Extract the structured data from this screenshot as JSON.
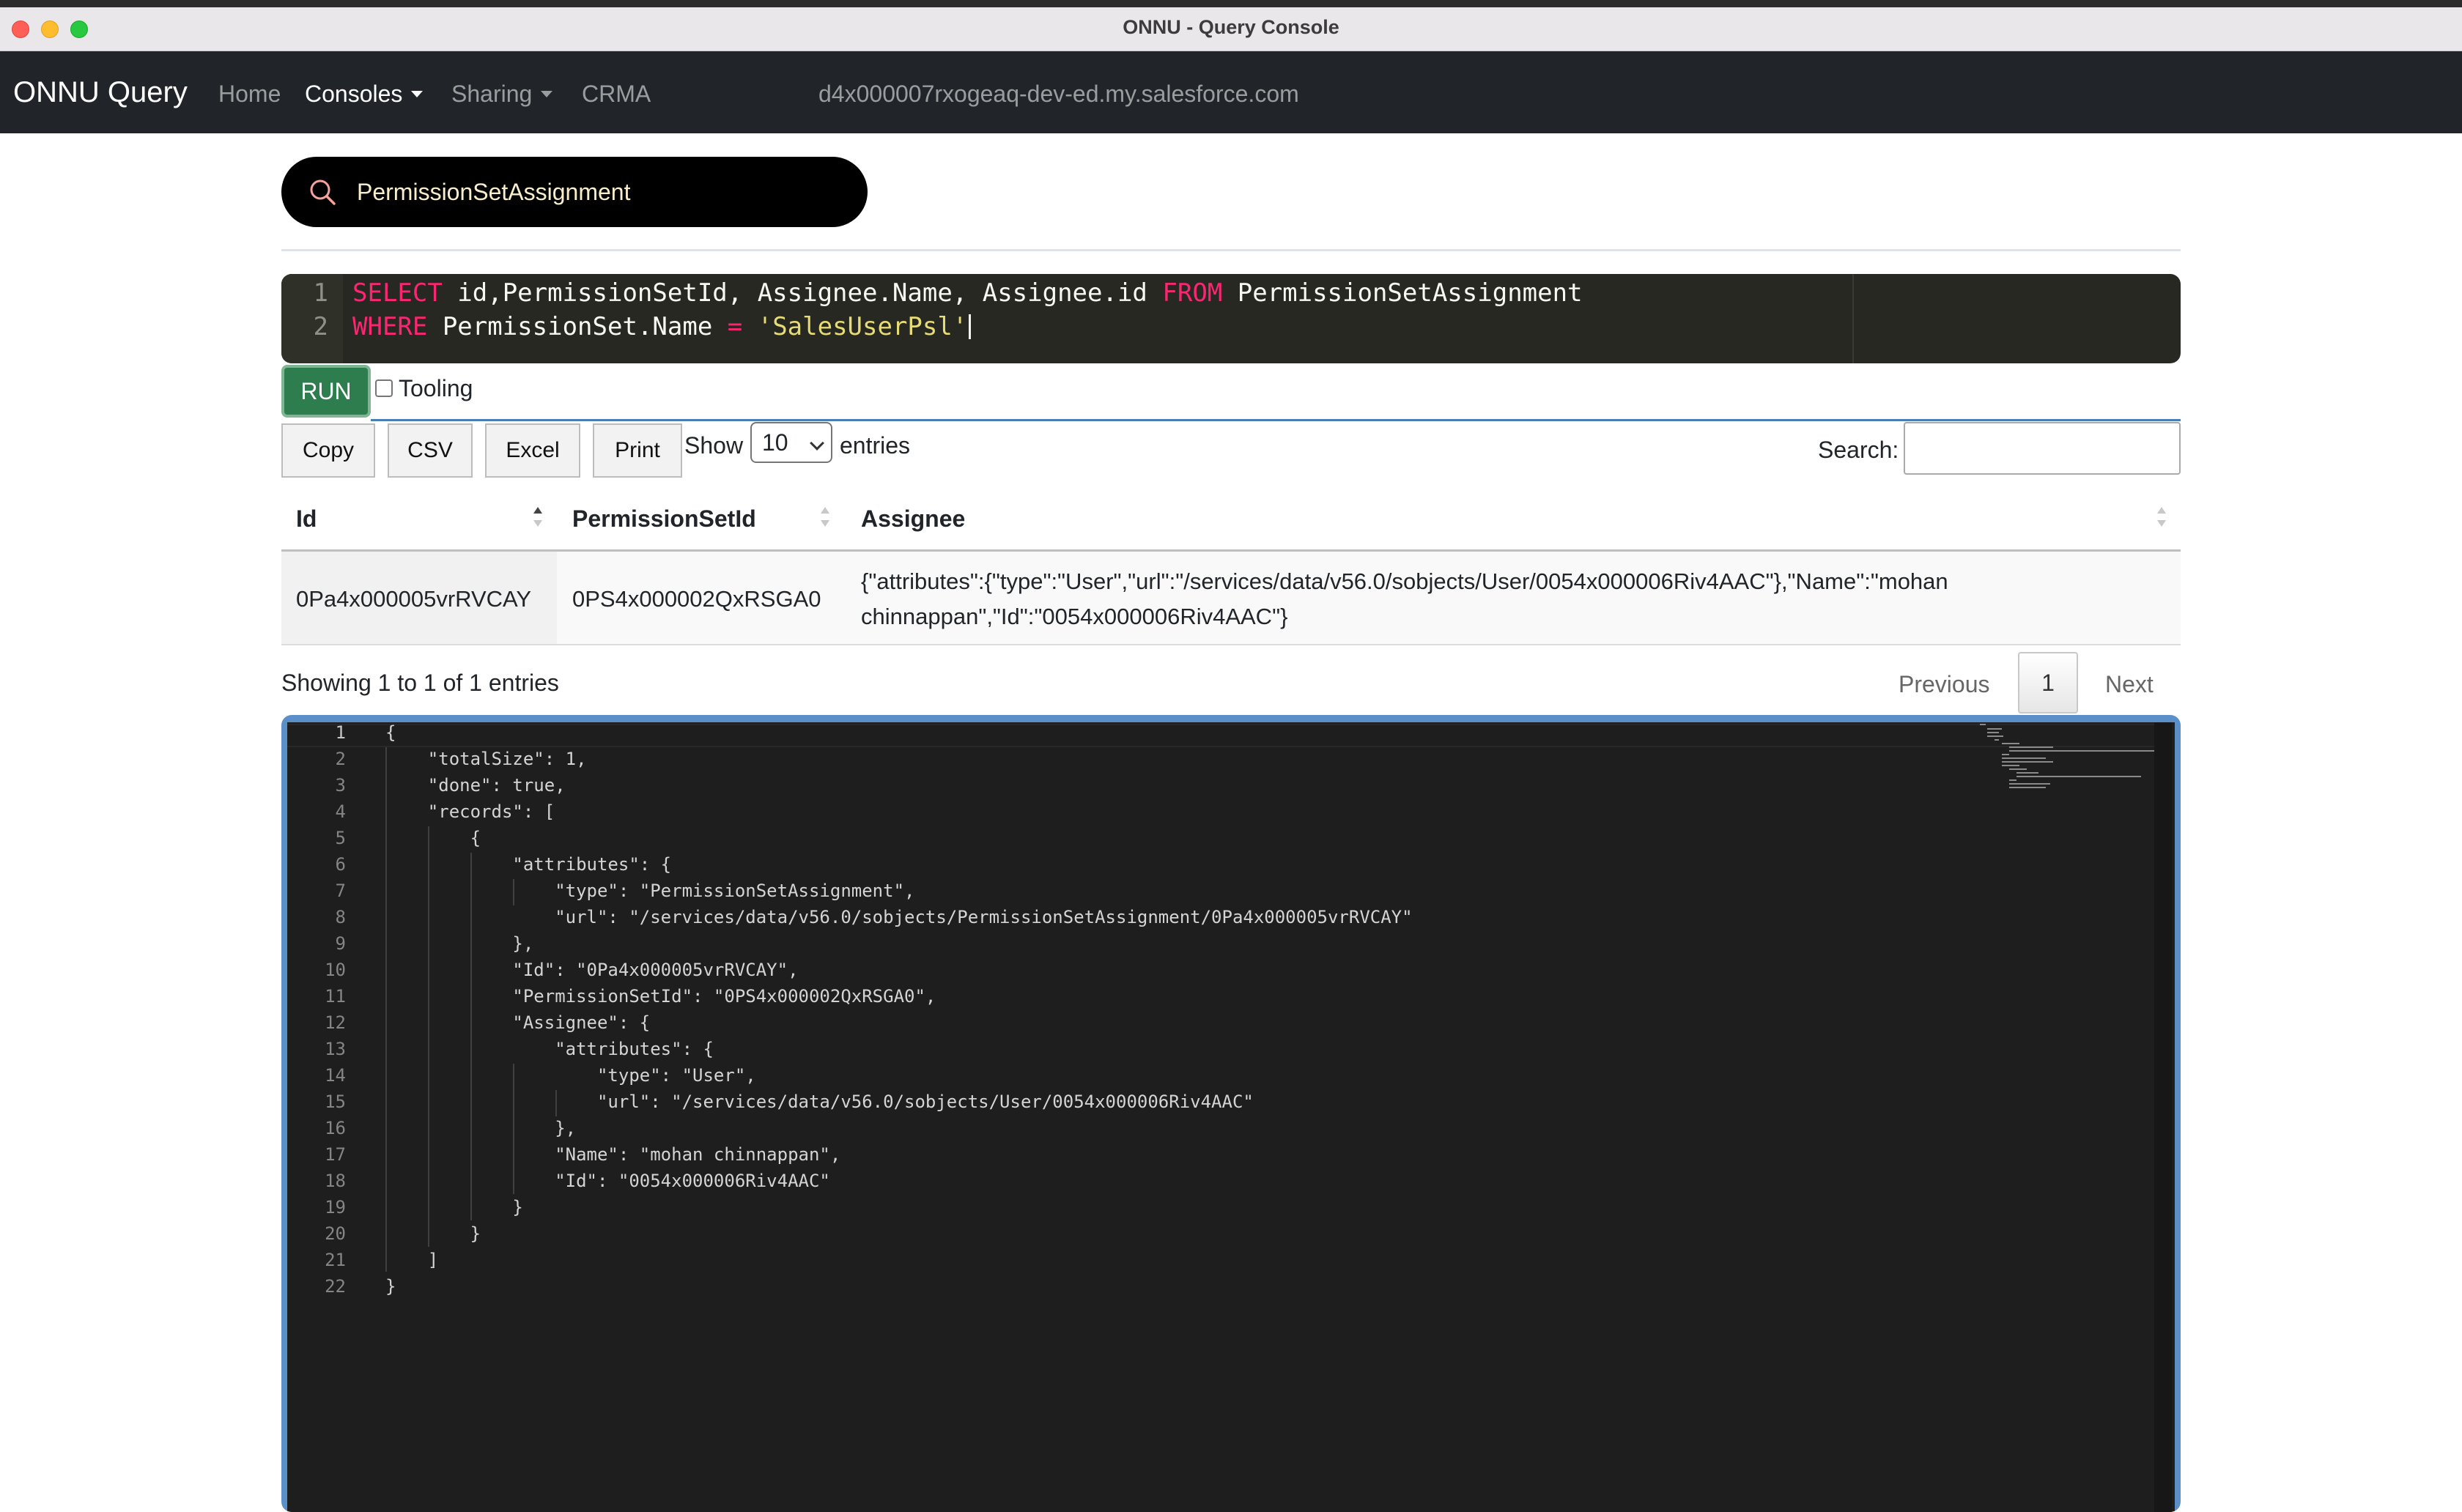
{
  "window": {
    "title": "ONNU - Query Console"
  },
  "navbar": {
    "brand": "ONNU Query",
    "links": {
      "home": "Home",
      "consoles": "Consoles",
      "sharing": "Sharing",
      "crma": "CRMA"
    },
    "host": "d4x000007rxogeaq-dev-ed.my.salesforce.com"
  },
  "search": {
    "value": "PermissionSetAssignment",
    "accent_color": "#f4a29b"
  },
  "editor": {
    "line_numbers": [
      "1",
      "2"
    ],
    "line1": {
      "kw1": "SELECT",
      "fields": " id,PermissionSetId, Assignee.Name, Assignee.id ",
      "kw2": "FROM",
      "object": " PermissionSetAssignment"
    },
    "line2": {
      "kw": "WHERE",
      "field": " PermissionSet.Name ",
      "op": "=",
      "space": " ",
      "value": "'SalesUserPsl'"
    }
  },
  "controls": {
    "run_label": "RUN",
    "tooling_label": "Tooling",
    "tooling_checked": false
  },
  "table_toolbar": {
    "buttons": {
      "copy": "Copy",
      "csv": "CSV",
      "excel": "Excel",
      "print": "Print"
    },
    "show_label": "Show",
    "entries_value": "10",
    "entries_label": "entries",
    "search_label": "Search:"
  },
  "table": {
    "columns": [
      "Id",
      "PermissionSetId",
      "Assignee"
    ],
    "rows": [
      {
        "id": "0Pa4x000005vrRVCAY",
        "permission_set_id": "0PS4x000002QxRSGA0",
        "assignee_line1": "{\"attributes\":{\"type\":\"User\",\"url\":\"/services/data/v56.0/sobjects/User/0054x000006Riv4AAC\"},\"Name\":\"mohan",
        "assignee_line2": "chinnappan\",\"Id\":\"0054x000006Riv4AAC\"}"
      }
    ]
  },
  "pagination": {
    "info": "Showing 1 to 1 of 1 entries",
    "previous": "Previous",
    "current": "1",
    "next": "Next"
  },
  "json_viewer": {
    "line_numbers": [
      "1",
      "2",
      "3",
      "4",
      "5",
      "6",
      "7",
      "8",
      "9",
      "10",
      "11",
      "12",
      "13",
      "14",
      "15",
      "16",
      "17",
      "18",
      "19",
      "20",
      "21",
      "22"
    ],
    "lines": [
      "{",
      "    \"totalSize\": 1,",
      "    \"done\": true,",
      "    \"records\": [",
      "        {",
      "            \"attributes\": {",
      "                \"type\": \"PermissionSetAssignment\",",
      "                \"url\": \"/services/data/v56.0/sobjects/PermissionSetAssignment/0Pa4x000005vrRVCAY\"",
      "            },",
      "            \"Id\": \"0Pa4x000005vrRVCAY\",",
      "            \"PermissionSetId\": \"0PS4x000002QxRSGA0\",",
      "            \"Assignee\": {",
      "                \"attributes\": {",
      "                    \"type\": \"User\",",
      "                    \"url\": \"/services/data/v56.0/sobjects/User/0054x000006Riv4AAC\"",
      "                },",
      "                \"Name\": \"mohan chinnappan\",",
      "                \"Id\": \"0054x000006Riv4AAC\"",
      "            }",
      "        }",
      "    ]",
      "}"
    ]
  }
}
